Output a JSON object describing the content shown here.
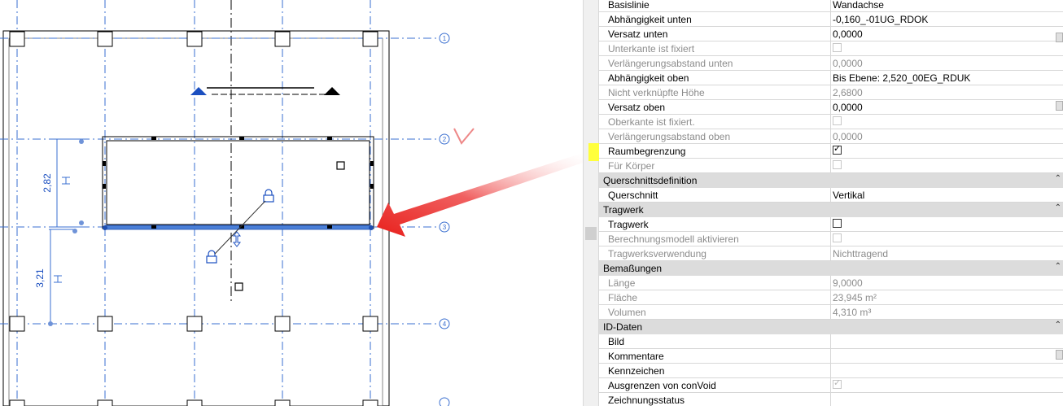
{
  "canvas": {
    "grid_bubbles": [
      "1",
      "2",
      "3",
      "4"
    ],
    "dimensions": [
      "2,82",
      "3,21"
    ]
  },
  "properties": {
    "rows": [
      {
        "label": "Basislinie",
        "value": "Wandachse",
        "disabled": false
      },
      {
        "label": "Abhängigkeit unten",
        "value": "-0,160_-01UG_RDOK",
        "disabled": false
      },
      {
        "label": "Versatz unten",
        "value": "0,0000",
        "disabled": false
      },
      {
        "label": "Unterkante ist fixiert",
        "value": "",
        "disabled": true,
        "checkbox": "unchecked"
      },
      {
        "label": "Verlängerungsabstand unten",
        "value": "0,0000",
        "disabled": true
      },
      {
        "label": "Abhängigkeit oben",
        "value": "Bis Ebene: 2,520_00EG_RDUK",
        "disabled": false
      },
      {
        "label": "Nicht verknüpfte Höhe",
        "value": "2,6800",
        "disabled": true
      },
      {
        "label": "Versatz oben",
        "value": "0,0000",
        "disabled": false
      },
      {
        "label": "Oberkante ist fixiert.",
        "value": "",
        "disabled": true,
        "checkbox": "unchecked"
      },
      {
        "label": "Verlängerungsabstand oben",
        "value": "0,0000",
        "disabled": true
      },
      {
        "label": "Raumbegrenzung",
        "value": "",
        "disabled": false,
        "checkbox": "checked",
        "highlight": true
      },
      {
        "label": "Für Körper",
        "value": "",
        "disabled": true,
        "checkbox": "unchecked"
      }
    ],
    "group_querschnitt": "Querschnittsdefinition",
    "querschnitt_rows": [
      {
        "label": "Querschnitt",
        "value": "Vertikal",
        "disabled": false
      }
    ],
    "group_tragwerk": "Tragwerk",
    "tragwerk_rows": [
      {
        "label": "Tragwerk",
        "value": "",
        "disabled": false,
        "checkbox": "unchecked"
      },
      {
        "label": "Berechnungsmodell aktivieren",
        "value": "",
        "disabled": true,
        "checkbox": "unchecked"
      },
      {
        "label": "Tragwerksverwendung",
        "value": "Nichttragend",
        "disabled": true
      }
    ],
    "group_bemassungen": "Bemaßungen",
    "bemassungen_rows": [
      {
        "label": "Länge",
        "value": "9,0000",
        "disabled": true
      },
      {
        "label": "Fläche",
        "value": "23,945 m²",
        "disabled": true
      },
      {
        "label": "Volumen",
        "value": "4,310 m³",
        "disabled": true
      }
    ],
    "group_id": "ID-Daten",
    "id_rows": [
      {
        "label": "Bild",
        "value": "",
        "disabled": false
      },
      {
        "label": "Kommentare",
        "value": "",
        "disabled": false
      },
      {
        "label": "Kennzeichen",
        "value": "",
        "disabled": false
      },
      {
        "label": "Ausgrenzen von conVoid",
        "value": "",
        "disabled": false,
        "checkbox": "checked-disabled"
      },
      {
        "label": "Zeichnungsstatus",
        "value": "",
        "disabled": false
      }
    ]
  },
  "colors": {
    "highlight": "#ffff3c",
    "grid_blue": "#3a6fd0",
    "selected_wall": "#4a7fd8",
    "arrow_red": "#e8201c"
  },
  "icons": [
    "lock-icon",
    "flip-arrows-icon",
    "collapse-chevron-icon",
    "view-marker-icon"
  ]
}
